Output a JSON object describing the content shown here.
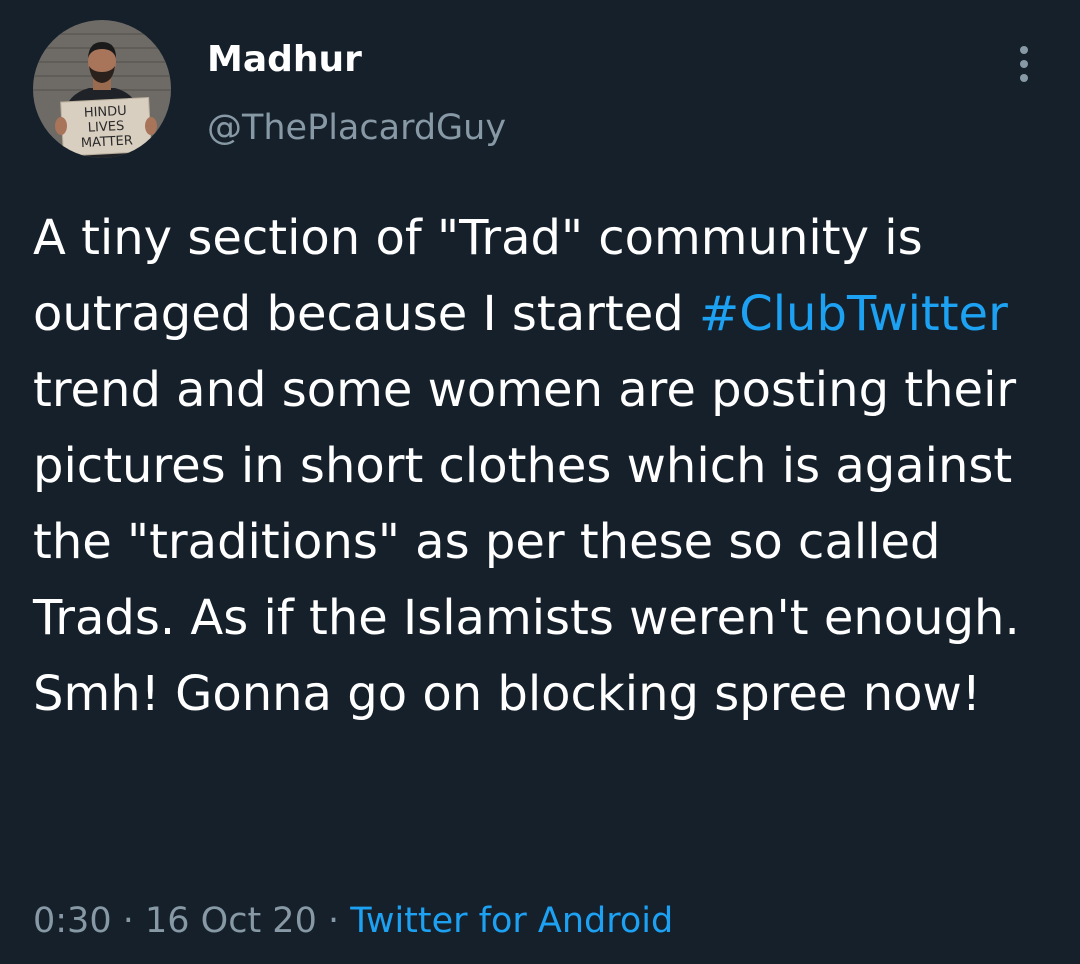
{
  "tweet": {
    "author": {
      "display_name": "Madhur",
      "handle": "@ThePlacardGuy",
      "avatar_placard_lines": [
        "HINDU",
        "LIVES",
        "MATTER"
      ]
    },
    "text": {
      "part1": "A tiny section of \"Trad\" community is outraged because I started ",
      "hashtag": "#ClubTwitter",
      "part2": " trend and some women are posting their pictures in short clothes which is against the \"traditions\" as per these so called Trads. As if the Islamists weren't enough. Smh! Gonna go on blocking spree now!"
    },
    "meta": {
      "time": "0:30",
      "separator": " · ",
      "date": "16 Oct 20",
      "source": "Twitter for Android"
    },
    "more_icon": "more-vertical-icon"
  },
  "colors": {
    "background": "#15202b",
    "text": "#ffffff",
    "secondary": "#8899a6",
    "link": "#1da1f2"
  }
}
